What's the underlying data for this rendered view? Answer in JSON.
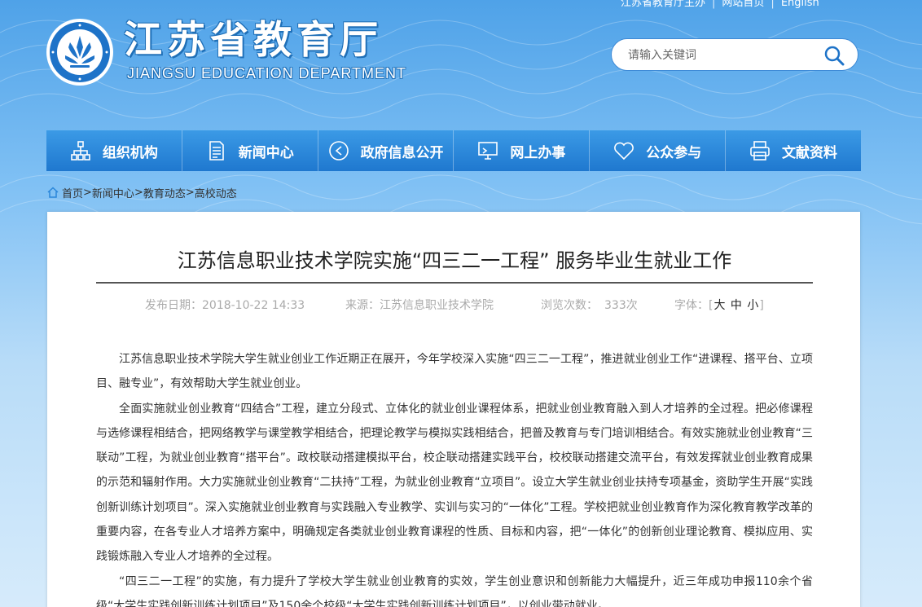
{
  "header": {
    "top_links": [
      "江苏省教育厅主办",
      "网站首页",
      "English"
    ],
    "title": "江苏省教育厅",
    "subtitle": "JIANGSU EDUCATION DEPARTMENT",
    "logo_icon": "ministry-seal-icon"
  },
  "search": {
    "placeholder": "请输入关键词",
    "value": "",
    "icon": "search-icon"
  },
  "nav": {
    "items": [
      {
        "label": "组织机构",
        "icon": "org-chart-icon"
      },
      {
        "label": "新闻中心",
        "icon": "document-icon"
      },
      {
        "label": "政府信息公开",
        "icon": "play-circle-icon"
      },
      {
        "label": "网上办事",
        "icon": "monitor-icon"
      },
      {
        "label": "公众参与",
        "icon": "heart-icon"
      },
      {
        "label": "文献资料",
        "icon": "printer-icon"
      }
    ]
  },
  "breadcrumb": {
    "items": [
      "首页",
      "新闻中心",
      "教育动态",
      "高校动态"
    ],
    "separator": ">"
  },
  "article": {
    "title": "江苏信息职业技术学院实施“四三二一工程” 服务毕业生就业工作",
    "meta": {
      "date_label": "发布日期：",
      "date": "2018-10-22 14:33",
      "source_label": "来源：",
      "source": "江苏信息职业技术学院",
      "views_label": "浏览次数：",
      "views": "333次",
      "font_label": "字体：",
      "font_sizes": [
        "大",
        "中",
        "小"
      ]
    },
    "paragraphs": [
      "江苏信息职业技术学院大学生就业创业工作近期正在展开，今年学校深入实施“四三二一工程”，推进就业创业工作“进课程、搭平台、立项目、融专业”，有效帮助大学生就业创业。",
      "全面实施就业创业教育“四结合”工程，建立分段式、立体化的就业创业课程体系，把就业创业教育融入到人才培养的全过程。把必修课程与选修课程相结合，把网络教学与课堂教学相结合，把理论教学与模拟实践相结合，把普及教育与专门培训相结合。有效实施就业创业教育“三联动”工程，为就业创业教育“搭平台”。政校联动搭建模拟平台，校企联动搭建实践平台，校校联动搭建交流平台，有效发挥就业创业教育成果的示范和辐射作用。大力实施就业创业教育“二扶持”工程，为就业创业教育“立项目”。设立大学生就业创业扶持专项基金，资助学生开展“实践创新训练计划项目”。深入实施就业创业教育与实践融入专业教学、实训与实习的“一体化”工程。学校把就业创业教育作为深化教育教学改革的重要内容，在各专业人才培养方案中，明确规定各类就业创业教育课程的性质、目标和内容，把“一体化”的创新创业理论教育、模拟应用、实践锻炼融入专业人才培养的全过程。",
      "“四三二一工程”的实施，有力提升了学校大学生就业创业教育的实效，学生创业意识和创新能力大幅提升，近三年成功申报110余个省级“大学生实践创新训练计划项目”及150余个校级“大学生实践创新训练计划项目”，以创业带动就业。"
    ]
  },
  "colors": {
    "nav_bg": "#2a86d9",
    "title_text": "#222222",
    "meta_text": "#aaaaaa",
    "body_text": "#333333"
  }
}
